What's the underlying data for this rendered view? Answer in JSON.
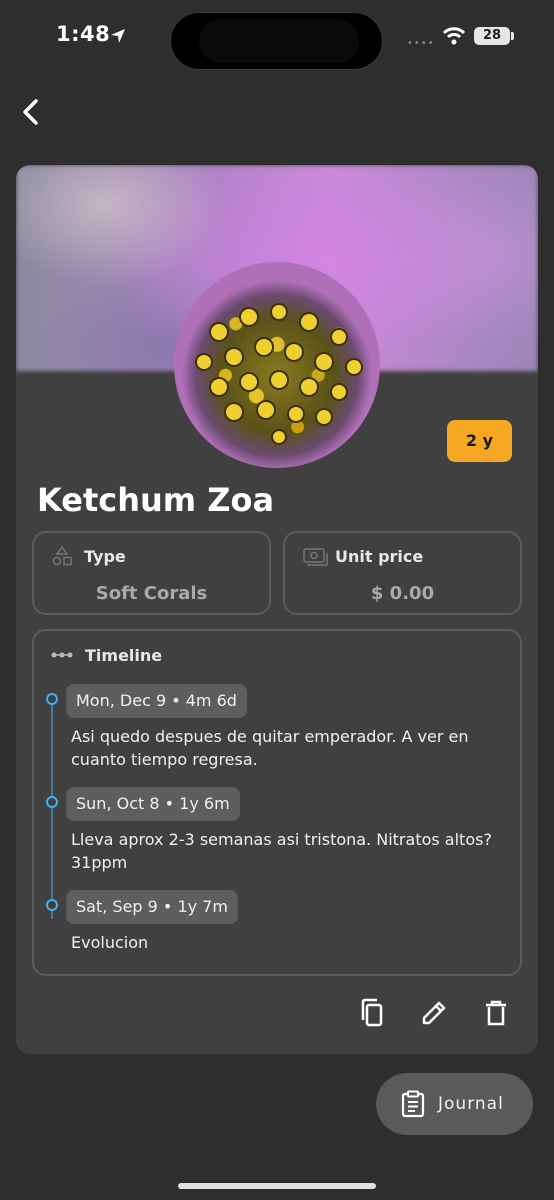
{
  "status_bar": {
    "time": "1:48",
    "battery": "28"
  },
  "header": {
    "back_icon": "chevron-left-icon"
  },
  "item": {
    "name": "Ketchum Zoa",
    "age_badge": "2 y",
    "type": {
      "label": "Type",
      "value": "Soft Corals",
      "icon": "shapes-icon"
    },
    "unit_price": {
      "label": "Unit price",
      "value": "$ 0.00",
      "icon": "cash-icon"
    }
  },
  "timeline": {
    "title": "Timeline",
    "icon": "timeline-icon",
    "entries": [
      {
        "date": "Mon, Dec 9 • 4m 6d",
        "text": "Asi quedo despues de quitar emperador. A ver en cuanto tiempo regresa."
      },
      {
        "date": "Sun, Oct 8 • 1y 6m",
        "text": "Lleva aprox 2-3 semanas asi tristona. Nitratos altos? 31ppm"
      },
      {
        "date": "Sat, Sep 9 • 1y 7m",
        "text": "Evolucion"
      }
    ]
  },
  "actions": {
    "copy_icon": "copy-icon",
    "edit_icon": "pencil-icon",
    "delete_icon": "trash-icon"
  },
  "fab": {
    "label": "Journal",
    "icon": "clipboard-icon"
  },
  "colors": {
    "accent": "#3fb0f0",
    "badge": "#f5a623",
    "card": "#404040",
    "background": "#2e2e2e"
  }
}
